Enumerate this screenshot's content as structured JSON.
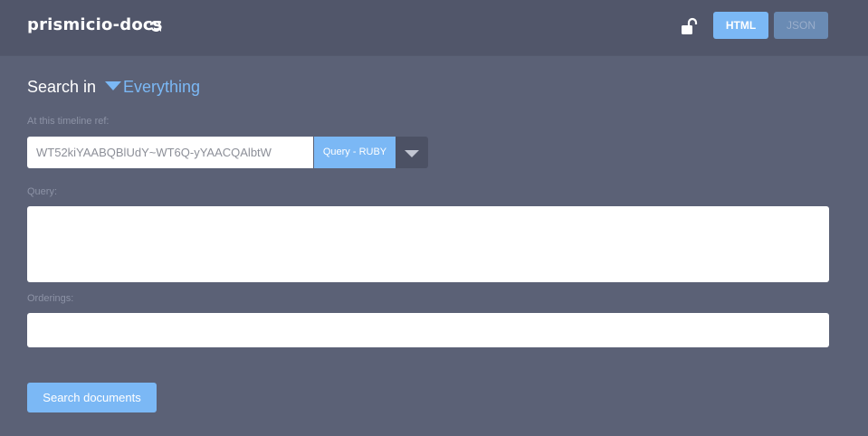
{
  "header": {
    "repo_name": "prismicio-docs",
    "refresh_icon": "refresh-icon",
    "lock_icon": "unlocked-padlock-icon",
    "format_buttons": [
      {
        "label": "HTML",
        "active": true
      },
      {
        "label": "JSON",
        "active": false
      }
    ]
  },
  "search": {
    "prefix": "Search in",
    "scope": "Everything"
  },
  "ref": {
    "label": "At this timeline ref:",
    "value": "WT52kiYAABQBlUdY~WT6Q-yYAACQAlbtW",
    "query_language": "Query - RUBY"
  },
  "query": {
    "label": "Query:",
    "value": ""
  },
  "orderings": {
    "label": "Orderings:",
    "value": ""
  },
  "submit": {
    "label": "Search documents"
  },
  "colors": {
    "background": "#5b6176",
    "header": "#51566a",
    "accent": "#7bb8f5",
    "accent_muted": "#6a8bb4",
    "label": "#8d93a6"
  }
}
